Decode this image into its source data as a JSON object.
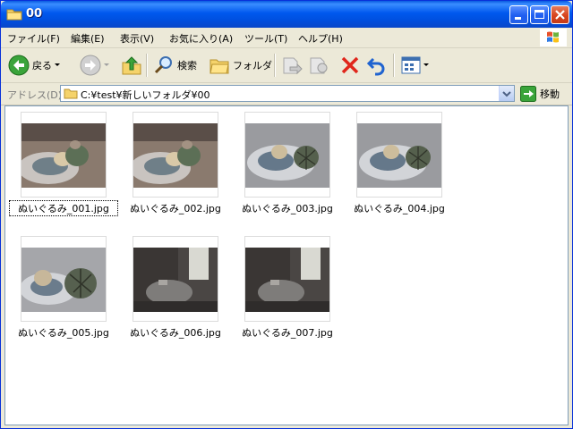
{
  "window": {
    "title": "00"
  },
  "menu": [
    "ファイル(F)",
    "編集(E)",
    "表示(V)",
    "お気に入り(A)",
    "ツール(T)",
    "ヘルプ(H)"
  ],
  "toolbar": {
    "back_label": "戻る",
    "search_label": "検索",
    "folders_label": "フォルダ"
  },
  "address": {
    "label": "アドレス(D)",
    "path": "C:¥test¥新しいフォルダ¥00",
    "go_label": "移動"
  },
  "files": [
    {
      "name": "ぬいぐるみ_001.jpg",
      "scene": "dim",
      "selected": true
    },
    {
      "name": "ぬいぐるみ_002.jpg",
      "scene": "dim",
      "selected": false
    },
    {
      "name": "ぬいぐるみ_003.jpg",
      "scene": "bright",
      "selected": false
    },
    {
      "name": "ぬいぐるみ_004.jpg",
      "scene": "bright",
      "selected": false
    },
    {
      "name": "ぬいぐるみ_005.jpg",
      "scene": "bright-close",
      "selected": false
    },
    {
      "name": "ぬいぐるみ_006.jpg",
      "scene": "dark",
      "selected": false
    },
    {
      "name": "ぬいぐるみ_007.jpg",
      "scene": "dark",
      "selected": false
    }
  ]
}
